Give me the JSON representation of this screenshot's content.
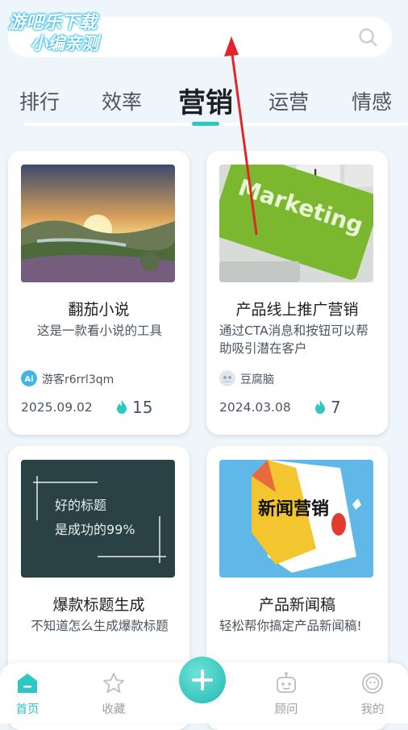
{
  "watermark": {
    "line1": "游吧乐下载",
    "line2": "小编亲测"
  },
  "search": {
    "icon": "search-icon"
  },
  "tabs": [
    {
      "label": "排行"
    },
    {
      "label": "效率"
    },
    {
      "label": "营销",
      "active": true
    },
    {
      "label": "运营"
    },
    {
      "label": "情感"
    }
  ],
  "cards": [
    {
      "title": "翻茄小说",
      "desc": "这是一款看小说的工具",
      "author": "游客r6rrl3qm",
      "date": "2025.09.02",
      "count": "15"
    },
    {
      "title": "产品线上推广营销",
      "desc": "通过CTA消息和按钮可以帮助吸引潜在客户",
      "author": "豆腐脑",
      "date": "2024.03.08",
      "count": "7",
      "thumb_text": "Marketing"
    },
    {
      "title": "爆款标题生成",
      "desc": "不知道怎么生成爆款标题",
      "thumb_line1": "好的标题",
      "thumb_line2": "是成功的99%"
    },
    {
      "title": "产品新闻稿",
      "desc": "轻松帮你搞定产品新闻稿!",
      "thumb_text": "新闻营销"
    }
  ],
  "nav": {
    "home": "首页",
    "favorites": "收藏",
    "advisor": "顾问",
    "mine": "我的"
  },
  "colors": {
    "accent": "#2ec8c4",
    "background": "#eef6fb",
    "annotation_arrow": "#e0262a"
  }
}
